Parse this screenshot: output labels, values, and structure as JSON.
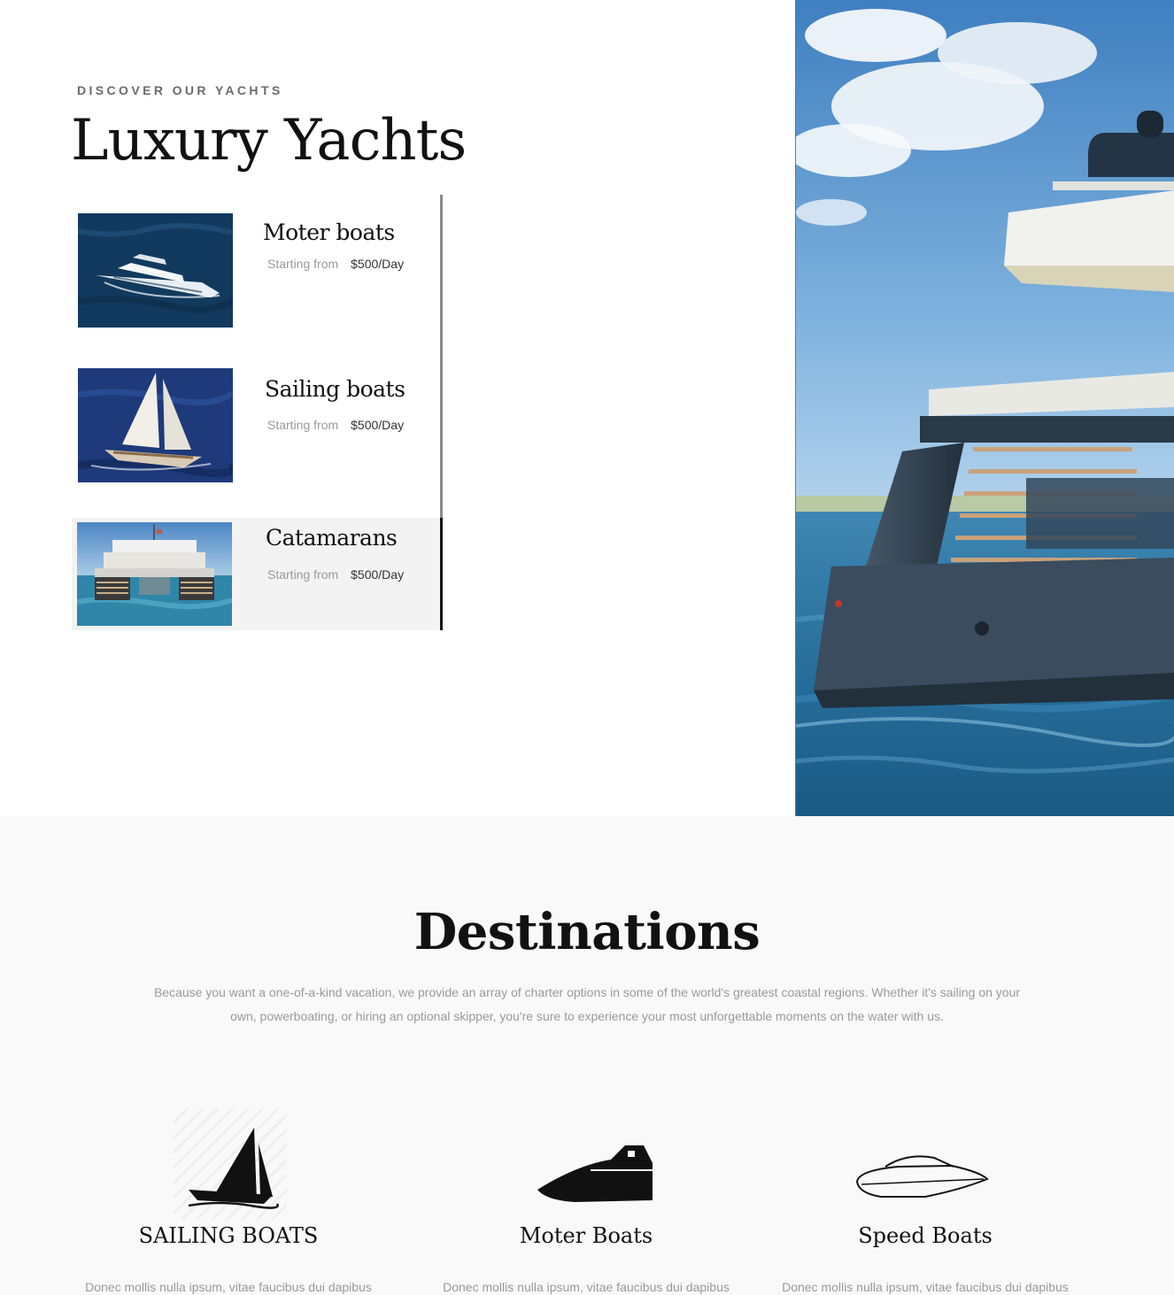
{
  "yachts_section": {
    "eyebrow": "DISCOVER OUR YACHTS",
    "title": "Luxury Yachts",
    "items": [
      {
        "name": "Moter boats",
        "starting_label": "Starting from",
        "price": "$500/Day",
        "active": false
      },
      {
        "name": "Sailing boats",
        "starting_label": "Starting from",
        "price": "$500/Day",
        "active": false
      },
      {
        "name": "Catamarans",
        "starting_label": "Starting from",
        "price": "$500/Day",
        "active": true
      }
    ]
  },
  "destinations": {
    "title": "Destinations",
    "description_line1": "Because you want a one-of-a-kind vacation, we provide an array of charter options in some of the world's greatest coastal regions. Whether it's sailing on your",
    "description_line2": "own, powerboating, or hiring an optional skipper, you're sure to experience your most unforgettable moments on the water with us.",
    "cards": [
      {
        "title": "SAILING BOATS",
        "text": "Donec mollis nulla ipsum, vitae faucibus dui dapibus",
        "icon": "sailboat-icon"
      },
      {
        "title": "Moter Boats",
        "text": "Donec mollis nulla ipsum, vitae faucibus dui dapibus",
        "icon": "motorboat-icon"
      },
      {
        "title": "Speed Boats",
        "text": "Donec mollis nulla ipsum, vitae faucibus dui dapibus",
        "icon": "speedboat-icon"
      }
    ]
  },
  "colors": {
    "text": "#111111",
    "muted": "#9a9a9a",
    "eyebrow": "#6b6b6b",
    "active_bg": "#f3f3f3",
    "section_bg": "#f9f9f9"
  }
}
